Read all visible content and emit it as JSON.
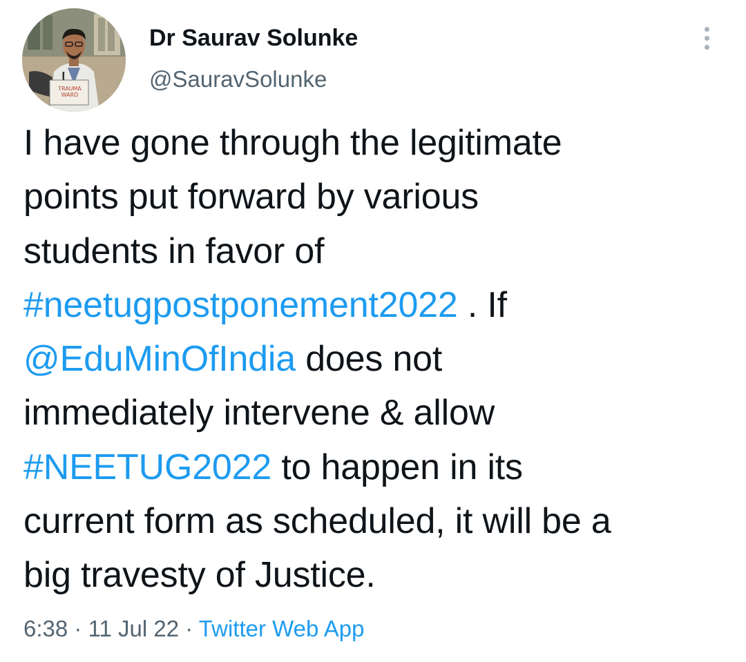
{
  "author": {
    "display_name": "Dr Saurav Solunke",
    "handle": "@SauravSolunke",
    "avatar_sign_text": "TRAUMA WARD"
  },
  "menu": {
    "icon": "more-vertical-icon"
  },
  "tweet": {
    "lines": [
      [
        {
          "text": "I have gone through the legitimate",
          "link": false
        }
      ],
      [
        {
          "text": "points put forward by various",
          "link": false
        }
      ],
      [
        {
          "text": "students in favor of",
          "link": false
        }
      ],
      [
        {
          "text": "#neetugpostponement2022",
          "link": true
        },
        {
          "text": " . If",
          "link": false
        }
      ],
      [
        {
          "text": "@EduMinOfIndia",
          "link": true
        },
        {
          "text": " does not",
          "link": false
        }
      ],
      [
        {
          "text": "immediately intervene & allow",
          "link": false
        }
      ],
      [
        {
          "text": "#NEETUG2022",
          "link": true
        },
        {
          "text": " to happen in its",
          "link": false
        }
      ],
      [
        {
          "text": "current form as scheduled, it will be a",
          "link": false
        }
      ],
      [
        {
          "text": "big travesty of Justice.",
          "link": false
        }
      ]
    ]
  },
  "meta": {
    "time": "6:38",
    "separator": " · ",
    "date": "11 Jul 22",
    "source": "Twitter Web App"
  },
  "colors": {
    "text": "#0f1419",
    "secondary": "#536471",
    "link": "#1d9bf0"
  }
}
